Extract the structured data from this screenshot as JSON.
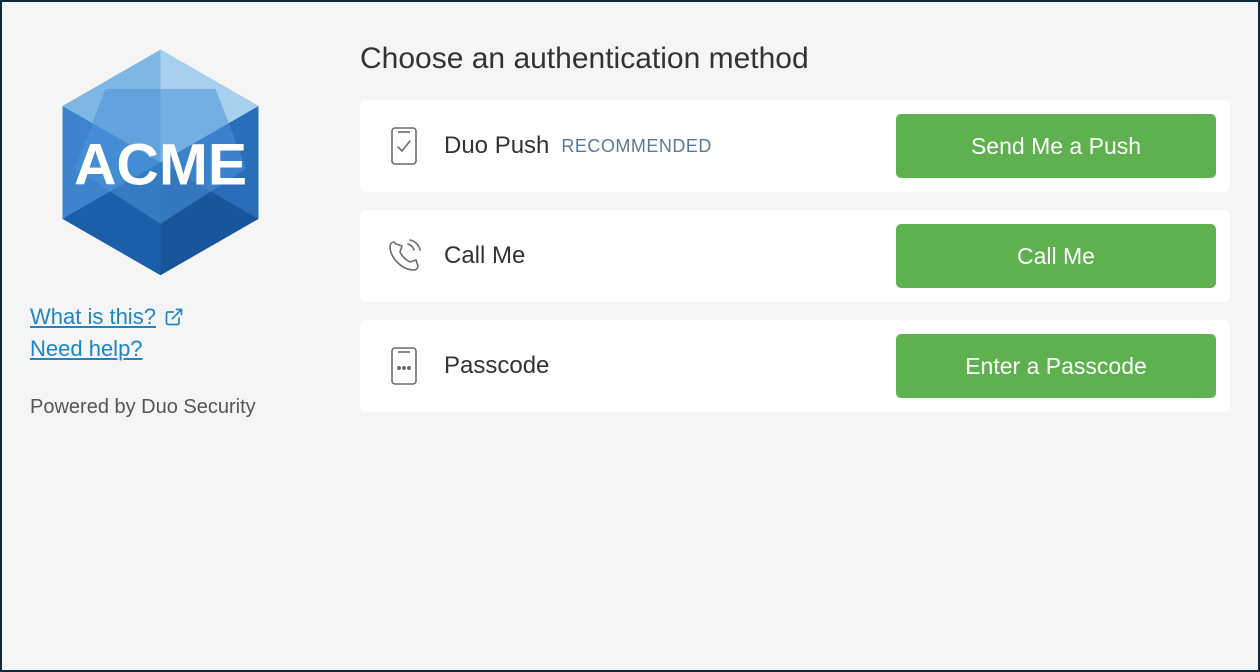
{
  "brand": "ACME",
  "links": {
    "what": "What is this?",
    "help": "Need help?"
  },
  "powered": "Powered by Duo Security",
  "title": "Choose an authentication method",
  "methods": [
    {
      "label": "Duo Push",
      "badge": "RECOMMENDED",
      "button": "Send Me a Push"
    },
    {
      "label": "Call Me",
      "badge": "",
      "button": "Call Me"
    },
    {
      "label": "Passcode",
      "badge": "",
      "button": "Enter a Passcode"
    }
  ],
  "colors": {
    "accent_green": "#5fb04e",
    "link_blue": "#1f85c7",
    "border_navy": "#0e2a3f"
  }
}
